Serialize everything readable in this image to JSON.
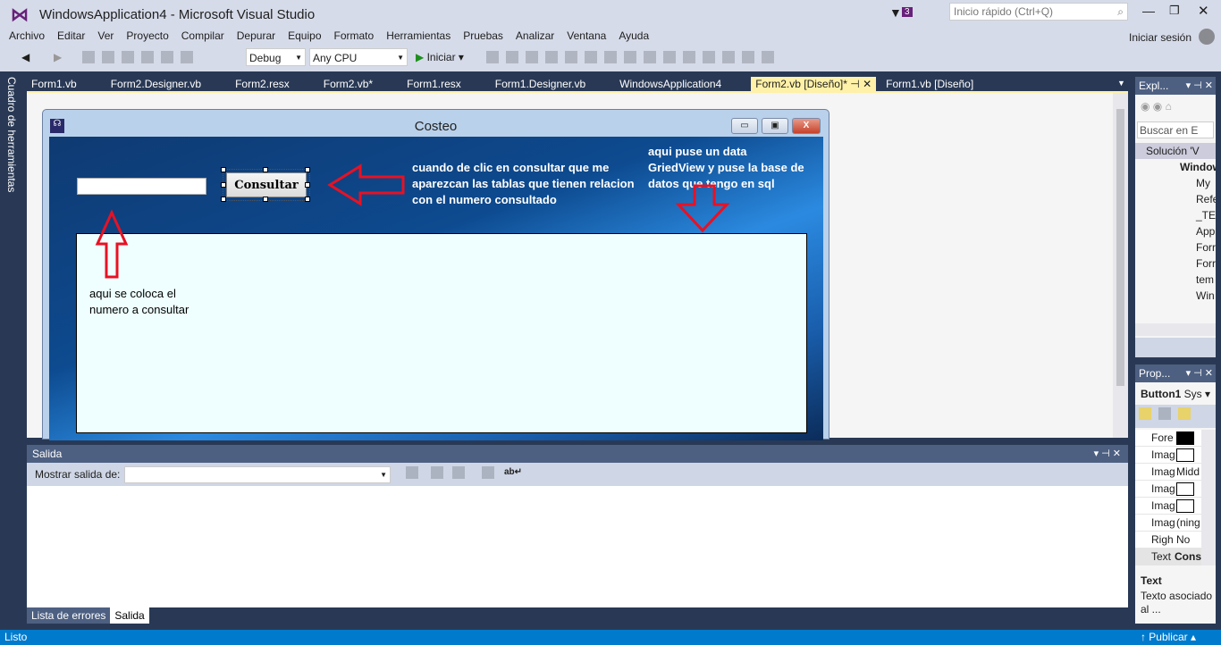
{
  "window": {
    "title": "WindowsApplication4 - Microsoft Visual Studio",
    "quick_launch_placeholder": "Inicio rápido (Ctrl+Q)",
    "notification_count": "3",
    "sign_in": "Iniciar sesión"
  },
  "menu": [
    "Archivo",
    "Editar",
    "Ver",
    "Proyecto",
    "Compilar",
    "Depurar",
    "Equipo",
    "Formato",
    "Herramientas",
    "Pruebas",
    "Analizar",
    "Ventana",
    "Ayuda"
  ],
  "toolbar": {
    "config": "Debug",
    "platform": "Any CPU",
    "start": "Iniciar"
  },
  "tabs": [
    {
      "label": "Form1.vb"
    },
    {
      "label": "Form2.Designer.vb"
    },
    {
      "label": "Form2.resx"
    },
    {
      "label": "Form2.vb*"
    },
    {
      "label": "Form1.resx"
    },
    {
      "label": "Form1.Designer.vb"
    },
    {
      "label": "WindowsApplication4"
    },
    {
      "label": "Form2.vb [Diseño]*",
      "active": true
    },
    {
      "label": "Form1.vb [Diseño]"
    }
  ],
  "toolbox_label": "Cuadro de herramientas",
  "form": {
    "title": "Costeo",
    "button_label": "Consultar",
    "notes": {
      "button": "cuando de clic en consultar que me aparezcan las tablas que tienen relacion con el numero consultado",
      "grid": "aqui puse un data GriedView y puse la base de datos que tengo en sql",
      "textbox": "aqui se coloca el numero a consultar"
    },
    "arrow_color": "#e81123"
  },
  "output": {
    "title": "Salida",
    "show_from_label": "Mostrar salida de:",
    "tabs": [
      "Lista de errores",
      "Salida"
    ]
  },
  "solution_explorer": {
    "title": "Expl...",
    "search_placeholder": "Buscar en E",
    "items": [
      "Solución 'V",
      "Window",
      "My",
      "Refe",
      "_TES",
      "App",
      "Forr",
      "Forr",
      "tem",
      "Win"
    ]
  },
  "properties": {
    "title": "Prop...",
    "object": "Button1",
    "object_type": "Sys",
    "rows": [
      {
        "name": "Fore",
        "value": ""
      },
      {
        "name": "Imag",
        "value": ""
      },
      {
        "name": "Imag",
        "value": "Midd"
      },
      {
        "name": "Imag",
        "value": ""
      },
      {
        "name": "Imag",
        "value": ""
      },
      {
        "name": "Imag",
        "value": "(ning"
      },
      {
        "name": "Righ",
        "value": "No"
      },
      {
        "name": "Text",
        "value": "Cons"
      }
    ],
    "desc_title": "Text",
    "desc": "Texto asociado al ..."
  },
  "status": {
    "text": "Listo",
    "publish": "Publicar"
  }
}
